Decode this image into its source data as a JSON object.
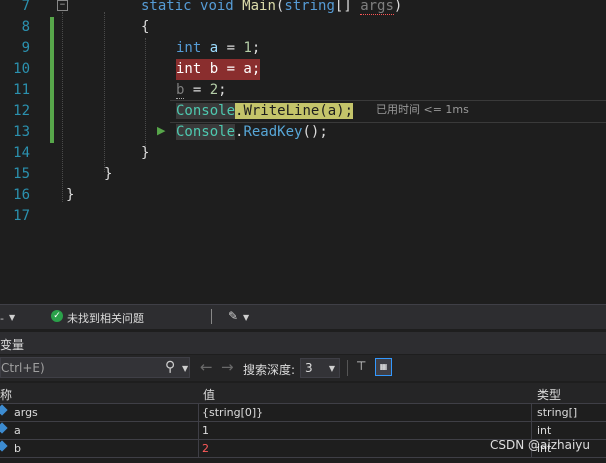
{
  "editor": {
    "line_numbers": [
      "7",
      "8",
      "9",
      "10",
      "11",
      "12",
      "13",
      "14",
      "15",
      "16",
      "17"
    ],
    "code": {
      "l7_static": "static",
      "l7_void": "void",
      "l7_main": "Main",
      "l7_paren": "(",
      "l7_string": "string",
      "l7_brackets": "[] ",
      "l7_args": "args",
      "l7_close": ")",
      "l8": "{",
      "l9_int": "int",
      "l9_a": "a",
      "l9_eq": " = ",
      "l9_val": "1",
      "l9_semi": ";",
      "l10_text": "int b = a;",
      "l11_b": "b",
      "l11_eq": " = ",
      "l11_val": "2",
      "l11_semi": ";",
      "l12_console": "Console",
      "l12_rest": ".WriteLine(a);",
      "l13_console": "Console",
      "l13_dot": ".",
      "l13_method": "ReadKey",
      "l13_rest": "();",
      "l14": "}",
      "l15": "}",
      "l16": "}"
    },
    "perf_tip": "已用时间 <= 1ms",
    "fold_symbol": "−"
  },
  "issues_bar": {
    "left_dash": "-",
    "message": "未找到相关问题",
    "ok_icon": "check-circle-icon",
    "brush_icon": "brush-icon"
  },
  "locals": {
    "title": "变量",
    "search_placeholder": "Ctrl+E)",
    "search_depth_label": "搜索深度:",
    "search_depth_value": "3",
    "columns": [
      "称",
      "值",
      "类型"
    ],
    "rows": [
      {
        "name": "args",
        "value": "{string[0]}",
        "type": "string[]",
        "changed": false
      },
      {
        "name": "a",
        "value": "1",
        "type": "int",
        "changed": false
      },
      {
        "name": "b",
        "value": "2",
        "type": "int",
        "changed": true
      }
    ]
  },
  "watermark": "CSDN @aizhaiyu",
  "colors": {
    "breakpoint_line": "#8a2e2e",
    "current_statement": "#c4c46a",
    "changed_value": "#ff5a5a",
    "line_numbers": "#2b91af"
  }
}
